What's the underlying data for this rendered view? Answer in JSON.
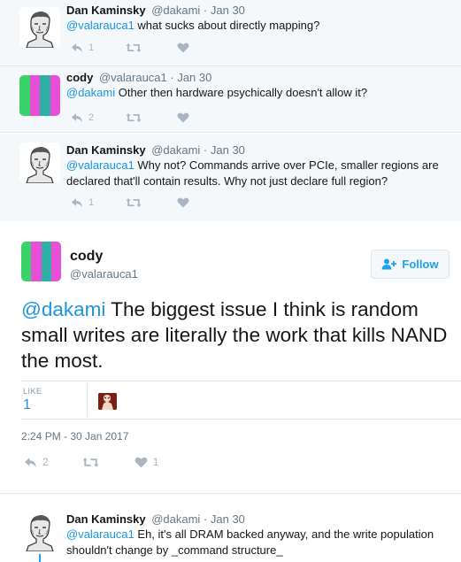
{
  "replies": [
    {
      "name": "Dan Kaminsky",
      "meta": "@dakami · Jan 30",
      "mention": "@valarauca1",
      "text": " what sucks about directly mapping?",
      "reply_count": "1",
      "avatar": "sketch-portrait"
    },
    {
      "name": "cody",
      "meta": "@valarauca1 · Jan 30",
      "mention": "@dakami",
      "text": " Other then hardware psychically doesn't allow it?",
      "reply_count": "2",
      "avatar": "color-stripes"
    },
    {
      "name": "Dan Kaminsky",
      "meta": "@dakami · Jan 30",
      "mention": "@valarauca1",
      "text": " Why not?  Commands arrive over PCIe, smaller regions are declared that'll contain results.  Why not just declare full region?",
      "reply_count": "1",
      "avatar": "sketch-portrait"
    }
  ],
  "main_tweet": {
    "name": "cody",
    "handle": "@valarauca1",
    "follow_label": "Follow",
    "mention": "@dakami",
    "text": " The biggest issue I think is random small writes are literally the work that kills NAND the most.",
    "likes_label": "LIKE",
    "likes_count": "1",
    "timestamp": "2:24 PM - 30 Jan 2017",
    "reply_count": "2",
    "like_count": "1"
  },
  "last_reply": {
    "name": "Dan Kaminsky",
    "meta": "@dakami · Jan 30",
    "mention": "@valarauca1",
    "text": " Eh, it's all DRAM backed anyway, and the write population shouldn't change by _command structure_"
  },
  "colors": {
    "link": "#1b95e0",
    "stripe_green": "#3ad36a",
    "stripe_magenta": "#e84fd6",
    "stripe_teal": "#2fb0a5"
  },
  "icons": [
    "reply-icon",
    "retweet-icon",
    "like-icon",
    "follow-person-icon"
  ]
}
